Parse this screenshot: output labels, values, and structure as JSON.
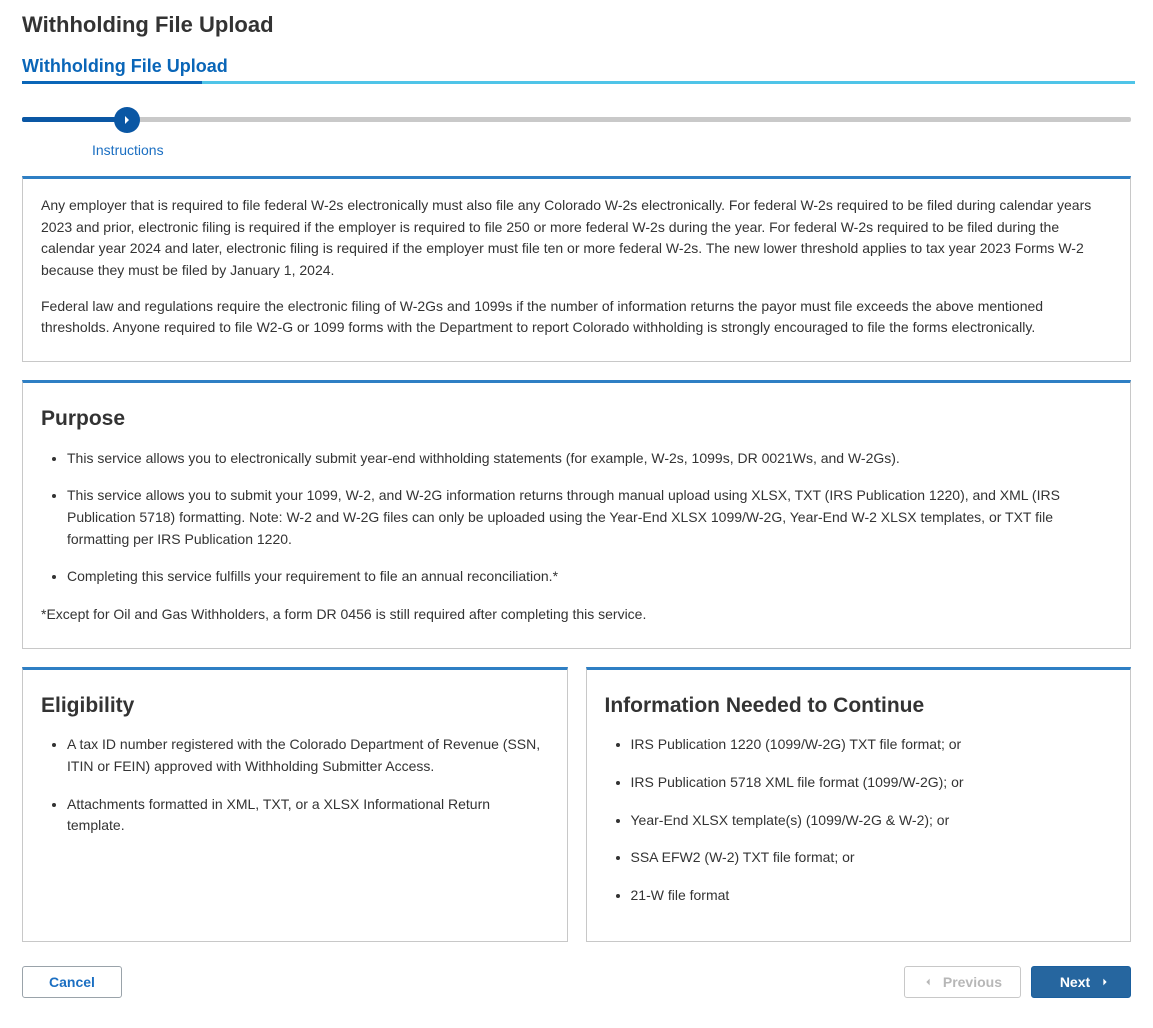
{
  "page": {
    "title": "Withholding File Upload"
  },
  "wizard": {
    "title": "Withholding File Upload",
    "step_label": "Instructions"
  },
  "intro": {
    "p1": "Any employer that is required to file federal W-2s electronically must also file any Colorado W-2s electronically. For federal W-2s required to be filed during calendar years 2023 and prior, electronic filing is required if the employer is required to file 250 or more federal W-2s during the year. For federal W-2s required to be filed during the calendar year 2024 and later, electronic filing is required if the employer must file ten or more federal W-2s. The new lower threshold applies to tax year 2023 Forms W-2 because they must be filed by January 1, 2024.",
    "p2": "Federal law and regulations require the electronic filing of W-2Gs and 1099s if the number of information returns the payor must file exceeds the above mentioned thresholds. Anyone required to file W2-G or 1099 forms with the Department to report Colorado withholding is strongly encouraged to file the forms electronically."
  },
  "purpose": {
    "heading": "Purpose",
    "items": [
      "This service allows you to electronically submit year-end withholding statements (for example, W-2s, 1099s, DR 0021Ws, and W-2Gs).",
      "This service allows you to submit your 1099, W-2, and W-2G information returns through manual upload using XLSX, TXT (IRS Publication 1220), and XML (IRS Publication 5718) formatting. Note: W-2 and W-2G files can only be uploaded using the Year-End XLSX 1099/W-2G, Year-End W-2 XLSX templates, or TXT file formatting per IRS Publication 1220.",
      "Completing this service fulfills your requirement to file an annual reconciliation.*"
    ],
    "footnote": "*Except for Oil and Gas Withholders, a form DR 0456 is still required after completing this service."
  },
  "eligibility": {
    "heading": "Eligibility",
    "items": [
      "A tax ID number registered with the Colorado Department of Revenue (SSN, ITIN or FEIN) approved with Withholding Submitter Access.",
      "Attachments formatted in XML, TXT, or a XLSX Informational Return template."
    ]
  },
  "info_needed": {
    "heading": "Information Needed to Continue",
    "items": [
      "IRS Publication 1220 (1099/W-2G) TXT file format; or",
      "IRS Publication 5718 XML file format (1099/W-2G); or",
      "Year-End XLSX template(s) (1099/W-2G & W-2); or",
      "SSA EFW2 (W-2) TXT file format; or",
      "21-W file format"
    ]
  },
  "footer": {
    "cancel": "Cancel",
    "previous": "Previous",
    "next": "Next"
  }
}
